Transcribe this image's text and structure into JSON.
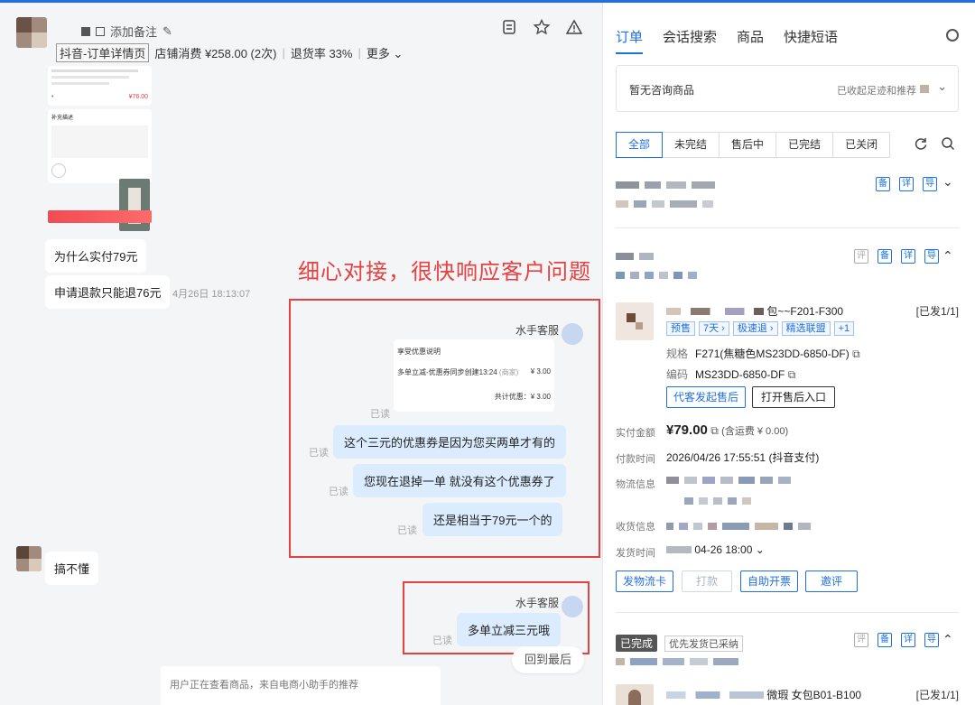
{
  "chat": {
    "header": {
      "add_note": "添加备注",
      "detail_tag": "抖音-订单详情页",
      "store_spend": "店铺消费 ¥258.00 (2次)",
      "return_rate": "退货率 33%",
      "more": "更多 ⌄"
    },
    "snapshot": {
      "price": "¥76.00",
      "remark_label": "补充描述"
    },
    "messages": [
      {
        "text": "为什么实付79元"
      },
      {
        "text": "申请退款只能退76元",
        "time": "4月26日 18:13:07"
      }
    ],
    "annotation": "细心对接，很快响应客户问题",
    "agent_name": "水手客服",
    "coupon": {
      "title": "享受优惠说明",
      "line": "多单立减-优惠券同步创建13:24",
      "line_tag": "(商家)",
      "line_amount": "¥ 3.00",
      "total": "共计优惠：¥ 3.00"
    },
    "agent_replies": [
      "这个三元的优惠券是因为您买两单才有的",
      "您现在退掉一单 就没有这个优惠券了",
      "还是相当于79元一个的"
    ],
    "read_label": "已读",
    "customer_reply": "搞不懂",
    "agent_reply2": "多单立减三元哦",
    "back_to_last": "回到最后",
    "recommend_tip": "用户正在查看商品，来自电商小助手的推荐"
  },
  "panel": {
    "tabs": [
      "订单",
      "会话搜索",
      "商品",
      "快捷短语"
    ],
    "consult_empty": "暂无咨询商品",
    "collapsed_hint": "已收起足迹和推荐",
    "filters": [
      "全部",
      "未完结",
      "售后中",
      "已完结",
      "已关闭"
    ],
    "order_icon_labels": [
      "评",
      "备",
      "详",
      "导"
    ],
    "order2": {
      "product_suffix": "包~~F201-F300",
      "ship_count": "[已发1/1]",
      "chips": [
        "预售",
        "7天 ›",
        "极速退 ›",
        "精选联盟",
        "+1"
      ],
      "spec_label": "规格",
      "spec_value": "F271(焦糖色MS23DD-6850-DF)",
      "code_label": "编码",
      "code_value": "MS23DD-6850-DF",
      "btn_after_sale": "代客发起售后",
      "btn_open_entry": "打开售后入口",
      "paid_label": "实付金额",
      "paid_value": "¥79.00",
      "paid_note": "(含运费 ¥ 0.00)",
      "pay_time_label": "付款时间",
      "pay_time_value": "2026/04/26 17:55:51 (抖音支付)",
      "logistics_label": "物流信息",
      "receiver_label": "收货信息",
      "ship_time_label": "发货时间",
      "ship_time_value": "04-26 18:00 ⌄",
      "btn_logistics_card": "发物流卡",
      "btn_refund": "打款",
      "btn_invoice": "自助开票",
      "btn_invite_review": "邀评"
    },
    "order3": {
      "status": "已完成",
      "priority": "优先发货已采纳",
      "product_suffix": "微瑕 女包B01-B100",
      "ship_count": "[已发1/1]"
    }
  }
}
